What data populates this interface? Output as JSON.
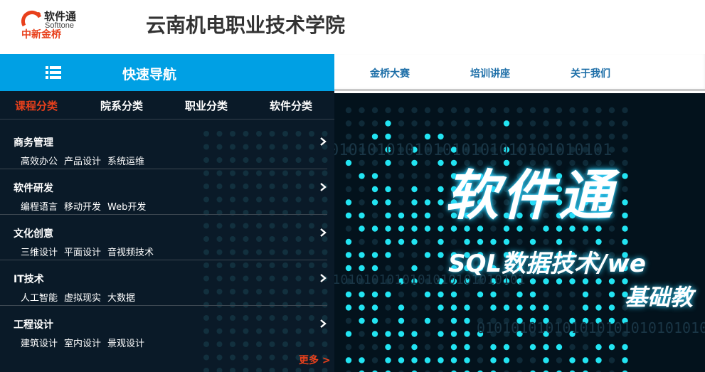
{
  "header": {
    "logo_cn": "软件通",
    "logo_en": "Softtone",
    "logo_sub": "中新金桥",
    "site_title": "云南机电职业技术学院"
  },
  "navbar": {
    "quicknav_label": "快速导航",
    "links": [
      "金桥大赛",
      "培训讲座",
      "关于我们"
    ]
  },
  "menu": {
    "tabs": [
      "课程分类",
      "院系分类",
      "职业分类",
      "软件分类"
    ],
    "active_tab": "课程分类",
    "groups": [
      {
        "title": "商务管理",
        "items": [
          "高效办公",
          "产品设计",
          "系统运维"
        ]
      },
      {
        "title": "软件研发",
        "items": [
          "编程语言",
          "移动开发",
          "Web开发"
        ]
      },
      {
        "title": "文化创意",
        "items": [
          "三维设计",
          "平面设计",
          "音视频技术"
        ]
      },
      {
        "title": "IT技术",
        "items": [
          "人工智能",
          "虚拟现实",
          "大数据"
        ]
      },
      {
        "title": "工程设计",
        "items": [
          "建筑设计",
          "室内设计",
          "景观设计"
        ]
      }
    ],
    "more_label": "更多 >"
  },
  "banner": {
    "title": "软件通",
    "subtitle_line1": "SQL数据技术/we",
    "subtitle_line2": "基础教",
    "binary_text": "0101010101010101010101010101010101"
  },
  "colors": {
    "brand_blue": "#00a0e4",
    "accent_orange": "#e8401c",
    "panel_bg": "#0a1a28",
    "link_blue": "#1e6fa8",
    "glow_cyan": "#2fd3ff"
  }
}
